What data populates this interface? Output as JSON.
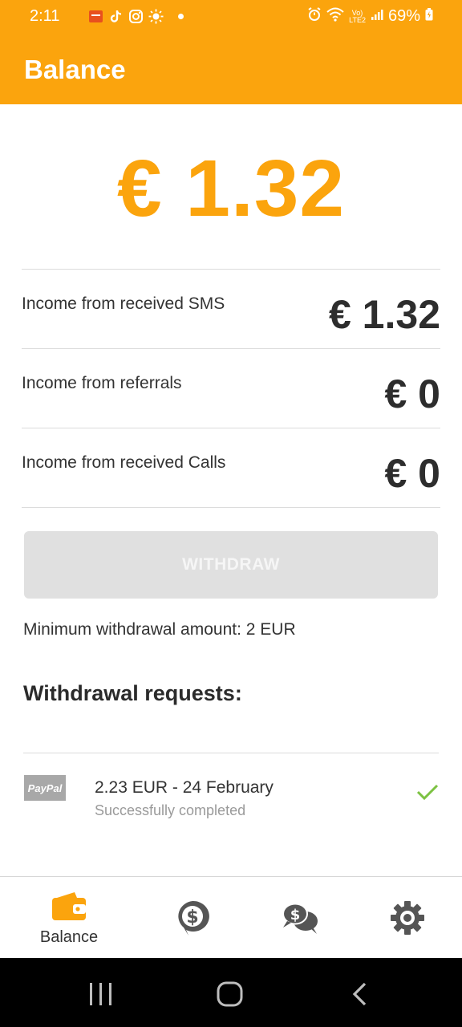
{
  "status_bar": {
    "time": "2:11",
    "battery": "69%",
    "signal_text": "LTE2"
  },
  "app_bar": {
    "title": "Balance"
  },
  "balance": {
    "amount": "€ 1.32"
  },
  "income": [
    {
      "label": "Income from received SMS",
      "amount": "€ 1.32"
    },
    {
      "label": "Income from referrals",
      "amount": "€ 0"
    },
    {
      "label": "Income from received Calls",
      "amount": "€ 0"
    }
  ],
  "withdraw": {
    "button_label": "WITHDRAW",
    "minimum_note": "Minimum withdrawal amount: 2 EUR"
  },
  "requests": {
    "title": "Withdrawal requests:",
    "items": [
      {
        "method": "PayPal",
        "summary": "2.23 EUR - 24 February",
        "status": "Successfully completed"
      }
    ]
  },
  "bottom_nav": {
    "items": [
      {
        "label": "Balance",
        "icon": "wallet-icon"
      },
      {
        "label": "",
        "icon": "dollar-chat-icon"
      },
      {
        "label": "",
        "icon": "dollar-chat-bubbles-icon"
      },
      {
        "label": "",
        "icon": "settings-gear-icon"
      }
    ]
  },
  "colors": {
    "accent": "#fba40d",
    "active_nav": "#fba40d",
    "inactive_nav": "#555555",
    "check": "#7cc242",
    "disabled_button": "#e0e0e0"
  }
}
